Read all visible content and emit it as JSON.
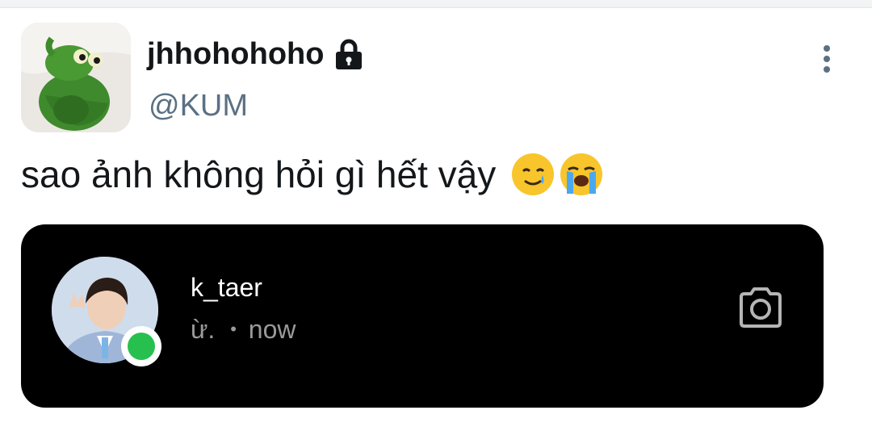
{
  "post": {
    "display_name": "jhhohohoho",
    "protected_icon": "lock-icon",
    "handle": "@KUM",
    "more_icon": "vertical-ellipsis-icon",
    "text": "sao ảnh không hỏi gì hết vậy",
    "emojis": [
      "smiling-face-with-tear",
      "loudly-crying-face"
    ]
  },
  "dm_card": {
    "username": "k_taer",
    "last_message": "ừ.",
    "separator": "•",
    "time": "now",
    "camera_icon": "camera-icon",
    "status": "online",
    "colors": {
      "background": "#000000",
      "online": "#27c04f",
      "secondary_text": "#9a9a9a"
    }
  },
  "colors": {
    "name": "#14171a",
    "handle": "#5b7083"
  }
}
